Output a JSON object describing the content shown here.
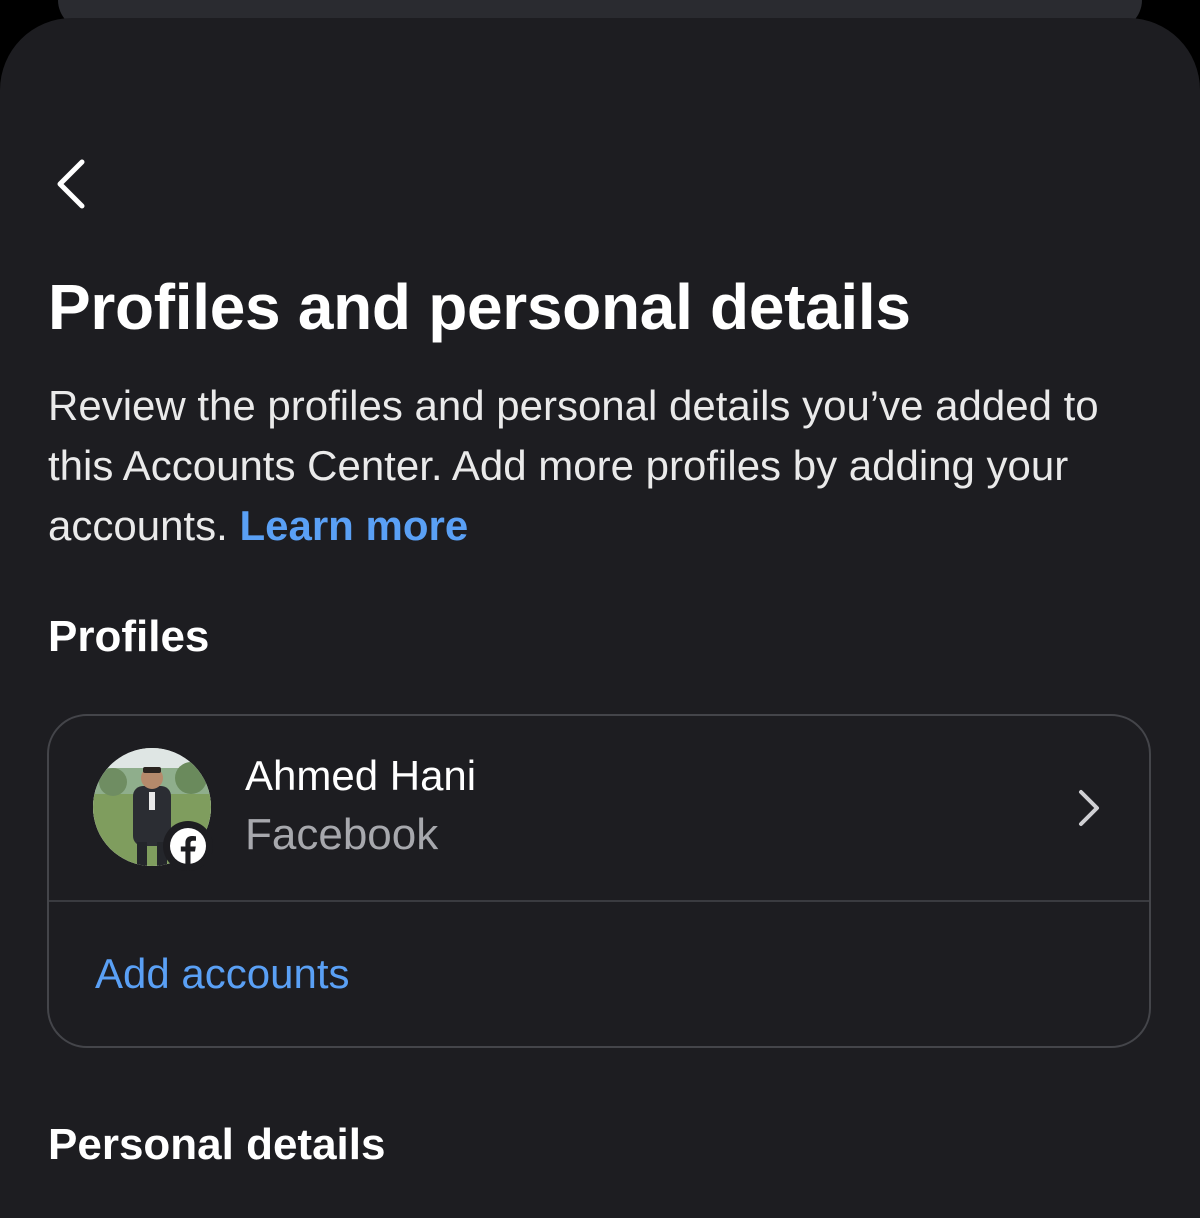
{
  "header": {
    "back_icon": "chevron-left-icon"
  },
  "page": {
    "title": "Profiles and personal details",
    "description": "Review the profiles and personal details you’ve added to this Accounts Center. Add more profiles by adding your accounts.",
    "learn_more_label": "Learn more"
  },
  "profiles_section": {
    "title": "Profiles",
    "items": [
      {
        "name": "Ahmed Hani",
        "platform": "Facebook",
        "badge_icon": "facebook-icon",
        "chevron_icon": "chevron-right-icon"
      }
    ],
    "add_accounts_label": "Add accounts"
  },
  "personal_details_section": {
    "title": "Personal details"
  },
  "colors": {
    "background": "#1d1d21",
    "text": "#ffffff",
    "secondary_text": "#a7a8ad",
    "link": "#5aa0f5",
    "card_border": "#44454a",
    "facebook": "#ffffff"
  }
}
